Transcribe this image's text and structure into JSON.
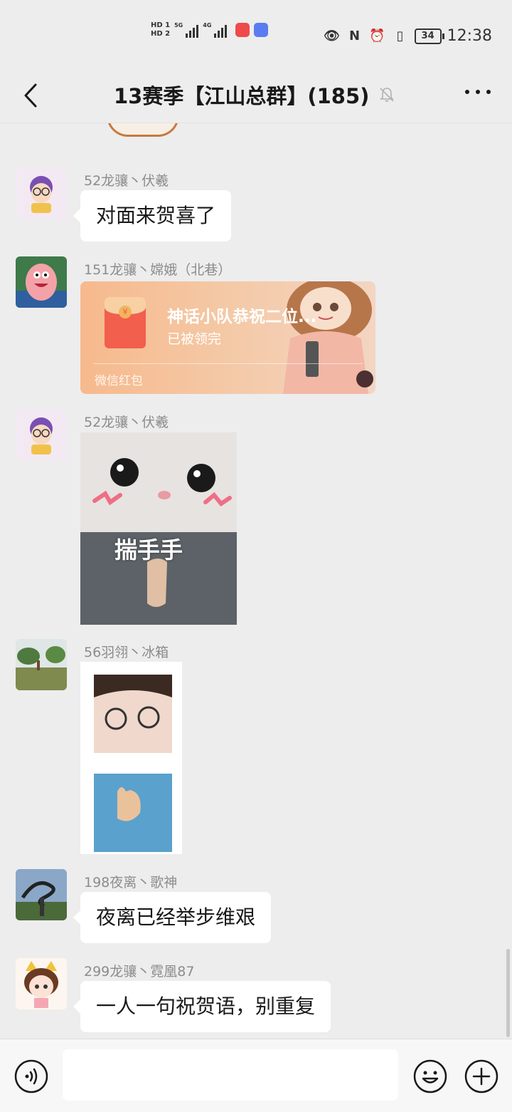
{
  "status_bar": {
    "hd1": "HD 1",
    "hd2": "HD 2",
    "net1": "5G",
    "net2": "4G",
    "battery": "34",
    "time": "12:38"
  },
  "header": {
    "title": "13赛季【江山总群】(185)"
  },
  "messages": [
    {
      "sender": "52龙骧丶伏羲",
      "text": "对面来贺喜了"
    },
    {
      "sender": "151龙骧丶嫦娥（北巷）",
      "red_packet": {
        "title": "神话小队恭祝二位...",
        "status": "已被领完",
        "footer": "微信红包"
      }
    },
    {
      "sender": "52龙骧丶伏羲",
      "sticker_caption": "揣手手"
    },
    {
      "sender": "56羽翎丶冰箱"
    },
    {
      "sender": "198夜离丶歌神",
      "text": "夜离已经举步维艰"
    },
    {
      "sender": "299龙骧丶霓凰87",
      "text": "一人一句祝贺语，别重复"
    }
  ],
  "colors": {
    "background": "#ededed",
    "bubble": "#ffffff",
    "sender_name": "#8c8c8c",
    "red_packet": "#f7b98d"
  },
  "icons": {
    "back": "chevron-left-icon",
    "mute": "bell-off-icon",
    "more": "more-dots-icon",
    "voice": "voice-icon",
    "emoji": "emoji-icon",
    "plus": "plus-icon"
  }
}
